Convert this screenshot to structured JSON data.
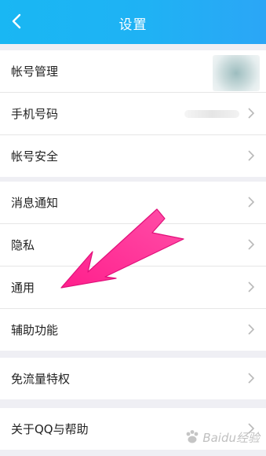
{
  "header": {
    "title": "设置"
  },
  "group1": {
    "items": [
      {
        "label": "帐号管理"
      },
      {
        "label": "手机号码"
      },
      {
        "label": "帐号安全"
      }
    ]
  },
  "group2": {
    "items": [
      {
        "label": "消息通知"
      },
      {
        "label": "隐私"
      },
      {
        "label": "通用"
      },
      {
        "label": "辅助功能"
      }
    ]
  },
  "group3": {
    "items": [
      {
        "label": "免流量特权"
      }
    ]
  },
  "group4": {
    "items": [
      {
        "label": "关于QQ与帮助"
      }
    ]
  },
  "colors": {
    "header": "#1fb2f4",
    "arrow": "#ff1f8c"
  },
  "watermark": {
    "text": "Baidu经验"
  }
}
